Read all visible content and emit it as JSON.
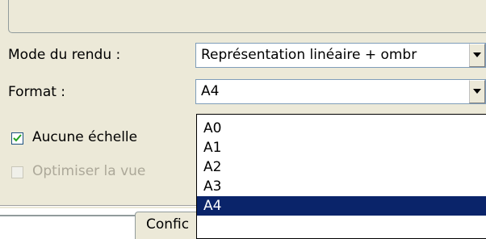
{
  "form": {
    "render_mode": {
      "label": "Mode du rendu :",
      "value": "Représentation linéaire + ombr"
    },
    "format": {
      "label": "Format :",
      "value": "A4",
      "options": [
        "A0",
        "A1",
        "A2",
        "A3",
        "A4"
      ],
      "selected_index": 4
    },
    "no_scale": {
      "label": "Aucune échelle",
      "checked": true
    },
    "optimize_view": {
      "label": "Optimiser la vue",
      "checked": false,
      "enabled": false
    }
  },
  "tabs": {
    "config_label": "Confic"
  },
  "colors": {
    "panel_bg": "#ece9d8",
    "selection_bg": "#0a246a",
    "disabled_text": "#aca899"
  }
}
